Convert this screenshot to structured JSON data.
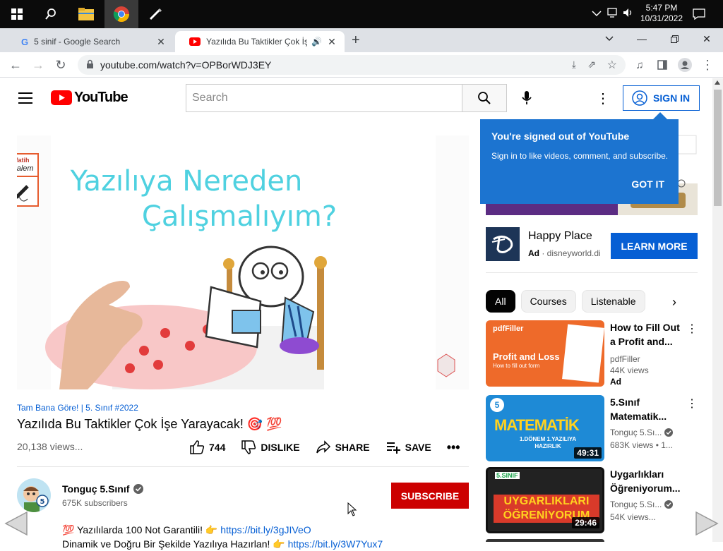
{
  "taskbar": {
    "time": "5:47 PM",
    "date": "10/31/2022"
  },
  "tabs": [
    {
      "title": "5 sinif - Google Search"
    },
    {
      "title": "Yazılıda Bu Taktikler Çok İşe Yarayacak! 🎯 💯 - YouTube"
    }
  ],
  "url": "youtube.com/watch?v=OPBorWDJ3EY",
  "yt": {
    "logo_text": "YouTube",
    "search_placeholder": "Search",
    "sign_in": "SIGN IN"
  },
  "popup": {
    "title": "You're signed out of YouTube",
    "text": "Sign in to like videos, comment, and subscribe.",
    "button": "GOT IT"
  },
  "player": {
    "overlay_brand_top": "fatih",
    "overlay_brand_bottom": "Kalem",
    "caption_line1": "Yazılıya Nereden",
    "caption_line2": "Çalışmalıyım?"
  },
  "video": {
    "hashtags": "Tam Bana Göre! | 5. Sınıf #2022",
    "title": "Yazılıda Bu Taktikler Çok İşe Yarayacak! 🎯 💯",
    "views": "20,138 views...",
    "likes": "744",
    "dislike": "DISLIKE",
    "share": "SHARE",
    "save": "SAVE"
  },
  "channel": {
    "name": "Tonguç 5.Sınıf",
    "subscribers": "675K subscribers",
    "subscribe": "SUBSCRIBE",
    "desc_line1": "💯 Yazılılarda 100 Not Garantili! 👉",
    "desc_link1": "https://bit.ly/3gJIVeO",
    "desc_line2": "Dinamik ve Doğru Bir Şekilde Yazılıya Hazırlan! 👉",
    "desc_link2": "https://bit.ly/3W7Yux7"
  },
  "ad": {
    "name": "Happy Place",
    "tag": "Ad",
    "domain": "disneyworld.di",
    "cta": "LEARN MORE"
  },
  "chips": [
    "All",
    "Courses",
    "Listenable"
  ],
  "recs": [
    {
      "title": "How to Fill Out a Profit and...",
      "channel": "pdfFiller",
      "views": "44K views",
      "badge": "Ad",
      "thumb_title": "Profit and Loss",
      "thumb_sub": "How to fill out form",
      "thumb_brand": "pdfFiller",
      "duration": ""
    },
    {
      "title": "5.Sınıf Matematik...",
      "channel": "Tonguç 5.Sı...",
      "views": "683K views  •  1...",
      "badge": "",
      "thumb_title": "MATEMATİK",
      "thumb_sub": "1.DÖNEM 1.YAZILIYA HAZIRLIK",
      "thumb_brand": "5",
      "duration": "49:31"
    },
    {
      "title": "Uygarlıkları Öğreniyorum...",
      "channel": "Tonguç 5.Sı...",
      "views": "54K views...",
      "badge": "",
      "thumb_title": "UYGARLIKLARI ÖĞRENİYORUM",
      "thumb_sub": "",
      "thumb_brand": "5.SINIF",
      "duration": "29:46"
    }
  ],
  "colors": {
    "yt_red": "#ff0000",
    "link_blue": "#065fd4",
    "popup_blue": "#1c74d0"
  }
}
